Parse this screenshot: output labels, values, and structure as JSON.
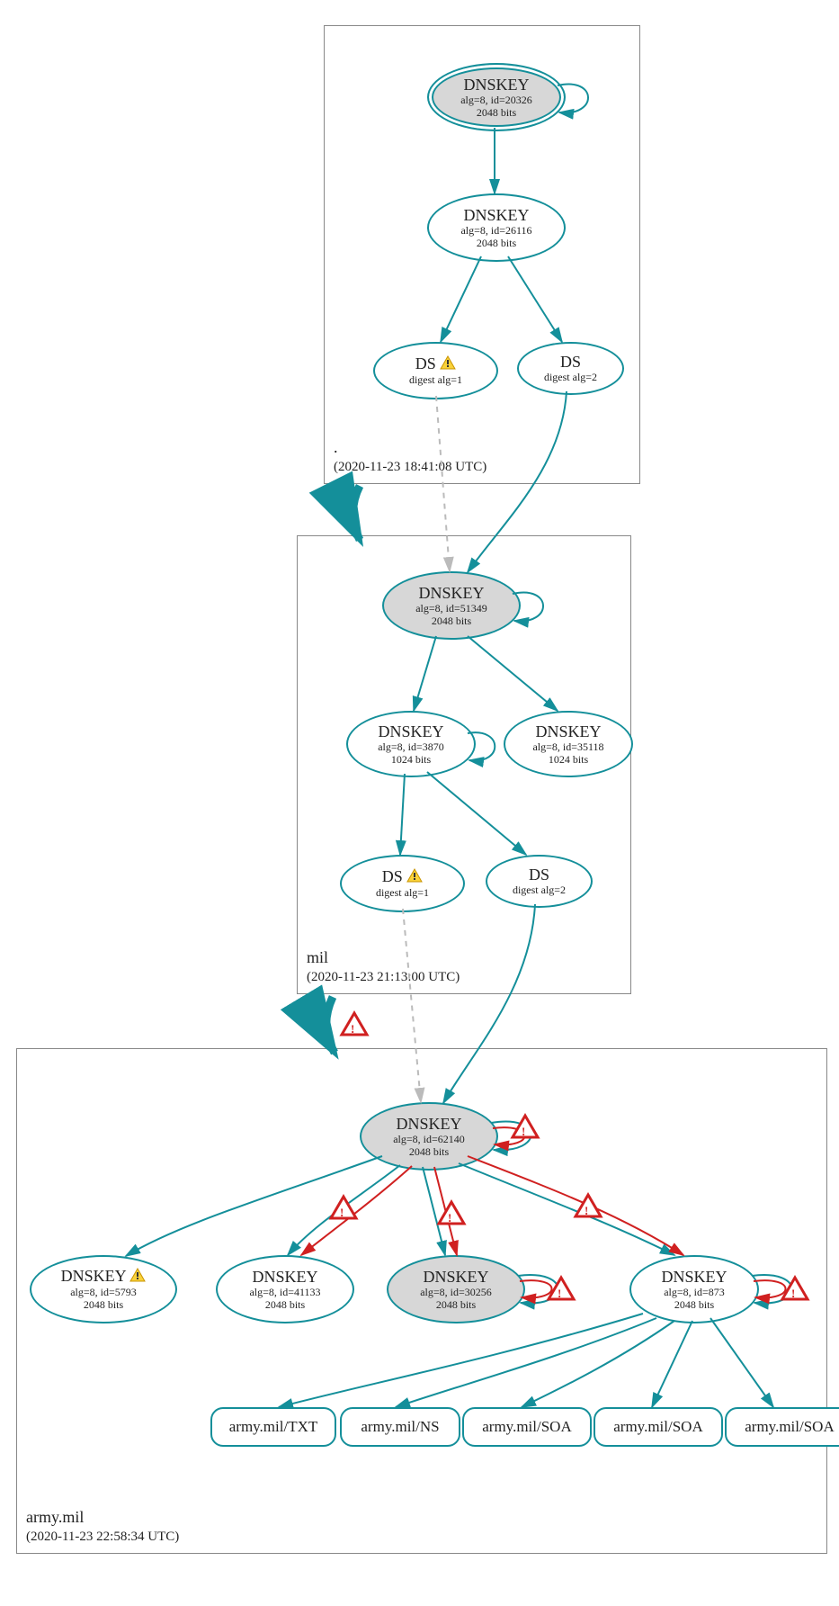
{
  "colors": {
    "stroke": "#148f9a",
    "error": "#d02020",
    "dashed": "#bbbbbb"
  },
  "zones": {
    "root": {
      "label": ".",
      "timestamp": "(2020-11-23 18:41:08 UTC)"
    },
    "mil": {
      "label": "mil",
      "timestamp": "(2020-11-23 21:13:00 UTC)"
    },
    "army": {
      "label": "army.mil",
      "timestamp": "(2020-11-23 22:58:34 UTC)"
    }
  },
  "nodes": {
    "root_ksk": {
      "title": "DNSKEY",
      "l1": "alg=8, id=20326",
      "l2": "2048 bits"
    },
    "root_zsk": {
      "title": "DNSKEY",
      "l1": "alg=8, id=26116",
      "l2": "2048 bits"
    },
    "root_ds1": {
      "title": "DS",
      "l1": "digest alg=1"
    },
    "root_ds2": {
      "title": "DS",
      "l1": "digest alg=2"
    },
    "mil_ksk": {
      "title": "DNSKEY",
      "l1": "alg=8, id=51349",
      "l2": "2048 bits"
    },
    "mil_zsk1": {
      "title": "DNSKEY",
      "l1": "alg=8, id=3870",
      "l2": "1024 bits"
    },
    "mil_zsk2": {
      "title": "DNSKEY",
      "l1": "alg=8, id=35118",
      "l2": "1024 bits"
    },
    "mil_ds1": {
      "title": "DS",
      "l1": "digest alg=1"
    },
    "mil_ds2": {
      "title": "DS",
      "l1": "digest alg=2"
    },
    "army_ksk": {
      "title": "DNSKEY",
      "l1": "alg=8, id=62140",
      "l2": "2048 bits"
    },
    "army_k1": {
      "title": "DNSKEY",
      "l1": "alg=8, id=5793",
      "l2": "2048 bits"
    },
    "army_k2": {
      "title": "DNSKEY",
      "l1": "alg=8, id=41133",
      "l2": "2048 bits"
    },
    "army_k3": {
      "title": "DNSKEY",
      "l1": "alg=8, id=30256",
      "l2": "2048 bits"
    },
    "army_k4": {
      "title": "DNSKEY",
      "l1": "alg=8, id=873",
      "l2": "2048 bits"
    }
  },
  "rrsets": {
    "r1": "army.mil/TXT",
    "r2": "army.mil/NS",
    "r3": "army.mil/SOA",
    "r4": "army.mil/SOA",
    "r5": "army.mil/SOA"
  },
  "icons": {
    "warn": "warning",
    "error": "error"
  }
}
